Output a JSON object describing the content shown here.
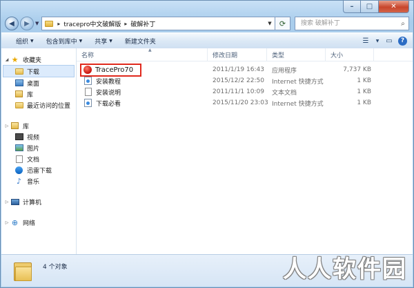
{
  "address": {
    "crumbs": [
      "tracepro中文破解版",
      "破解补丁"
    ]
  },
  "search": {
    "placeholder": "搜索 破解补丁"
  },
  "toolbar": {
    "organize": "组织",
    "include_library": "包含到库中",
    "share": "共享",
    "new_folder": "新建文件夹"
  },
  "nav": {
    "favorites": "收藏夹",
    "fav_items": [
      "下载",
      "桌面",
      "库",
      "最近访问的位置"
    ],
    "libraries": "库",
    "lib_items": [
      "视频",
      "图片",
      "文档",
      "迅雷下载",
      "音乐"
    ],
    "computer": "计算机",
    "network": "网络"
  },
  "columns": {
    "name": "名称",
    "date": "修改日期",
    "type": "类型",
    "size": "大小"
  },
  "files": [
    {
      "name": "TracePro70",
      "date": "2011/1/19 16:43",
      "type": "应用程序",
      "size": "7,737 KB",
      "icon": "exe-icon"
    },
    {
      "name": "安装教程",
      "date": "2015/12/2 22:50",
      "type": "Internet 快捷方式",
      "size": "1 KB",
      "icon": "url-shortcut-icon"
    },
    {
      "name": "安装说明",
      "date": "2011/11/1 10:09",
      "type": "文本文档",
      "size": "1 KB",
      "icon": "text-document-icon"
    },
    {
      "name": "下载必看",
      "date": "2015/11/20 23:03",
      "type": "Internet 快捷方式",
      "size": "1 KB",
      "icon": "url-shortcut-icon"
    }
  ],
  "status": {
    "count": "4 个对象"
  },
  "watermark": "人人软件园",
  "colors": {
    "highlight": "#e0281c",
    "selection": "#dcebfc"
  }
}
